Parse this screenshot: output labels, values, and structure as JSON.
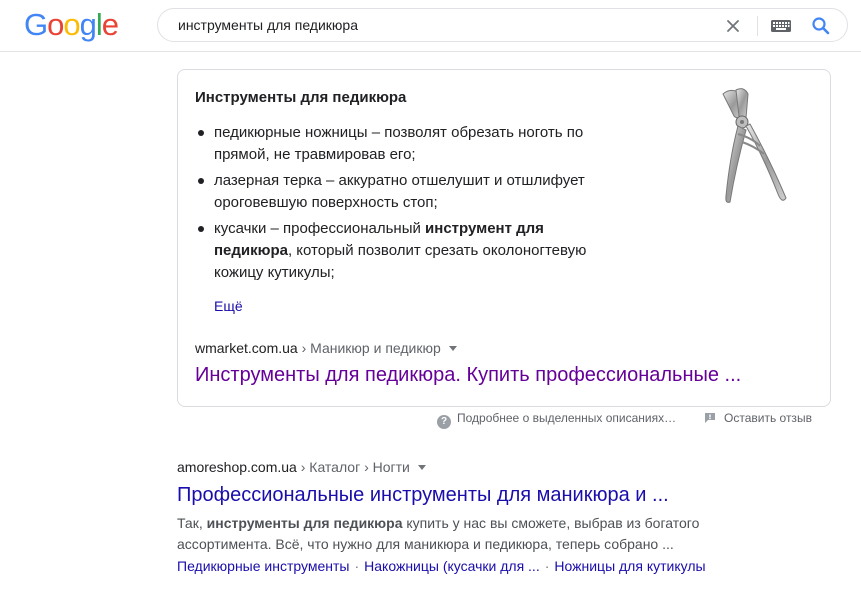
{
  "logo": {
    "letters": [
      "G",
      "o",
      "o",
      "g",
      "l",
      "e"
    ],
    "colors": [
      "#4285F4",
      "#EA4335",
      "#FBBC05",
      "#4285F4",
      "#34A853",
      "#EA4335"
    ]
  },
  "search": {
    "query": "инструменты для педикюра"
  },
  "icons": {
    "clear": "close-icon",
    "keyboard": "keyboard-icon",
    "search": "search-icon",
    "about": "help-icon",
    "feedback": "feedback-icon"
  },
  "snippet": {
    "title": "Инструменты для педикюра",
    "items": [
      {
        "text": "педикюрные ножницы – позволят обрезать ноготь по прямой, не травмировав его;"
      },
      {
        "text": "лазерная терка – аккуратно отшелушит и отшлифует ороговевшую поверхность стоп;"
      },
      {
        "pre": "кусачки – профессиональный ",
        "bold": "инструмент для педикюра",
        "post": ", который позволит срезать околоногтевую кожицу кутикулы;"
      }
    ],
    "more": "Ещё",
    "image": "nail-clippers-image",
    "cite_domain": "wmarket.com.ua",
    "cite_path": " › Маникюр и педикюр",
    "link": "Инструменты для педикюра. Купить профессиональные ..."
  },
  "below_card": {
    "about": "Подробнее о выделенных описаниях…",
    "feedback": "Оставить отзыв"
  },
  "result": {
    "cite_domain": "amoreshop.com.ua",
    "cite_path": " › Каталог › Ногти",
    "title": "Профессиональные инструменты для маникюра и ...",
    "desc_pre": "Так, ",
    "desc_bold": "инструменты для педикюра",
    "desc_post": " купить у нас вы сможете, выбрав из богатого ассортимента. Всё, что нужно для маникюра и педикюра, теперь собрано ...",
    "sitelinks": [
      "Педикюрные инструменты",
      "Накожницы (кусачки для ...",
      "Ножницы для кутикулы"
    ],
    "sitelink_separator": "·"
  }
}
